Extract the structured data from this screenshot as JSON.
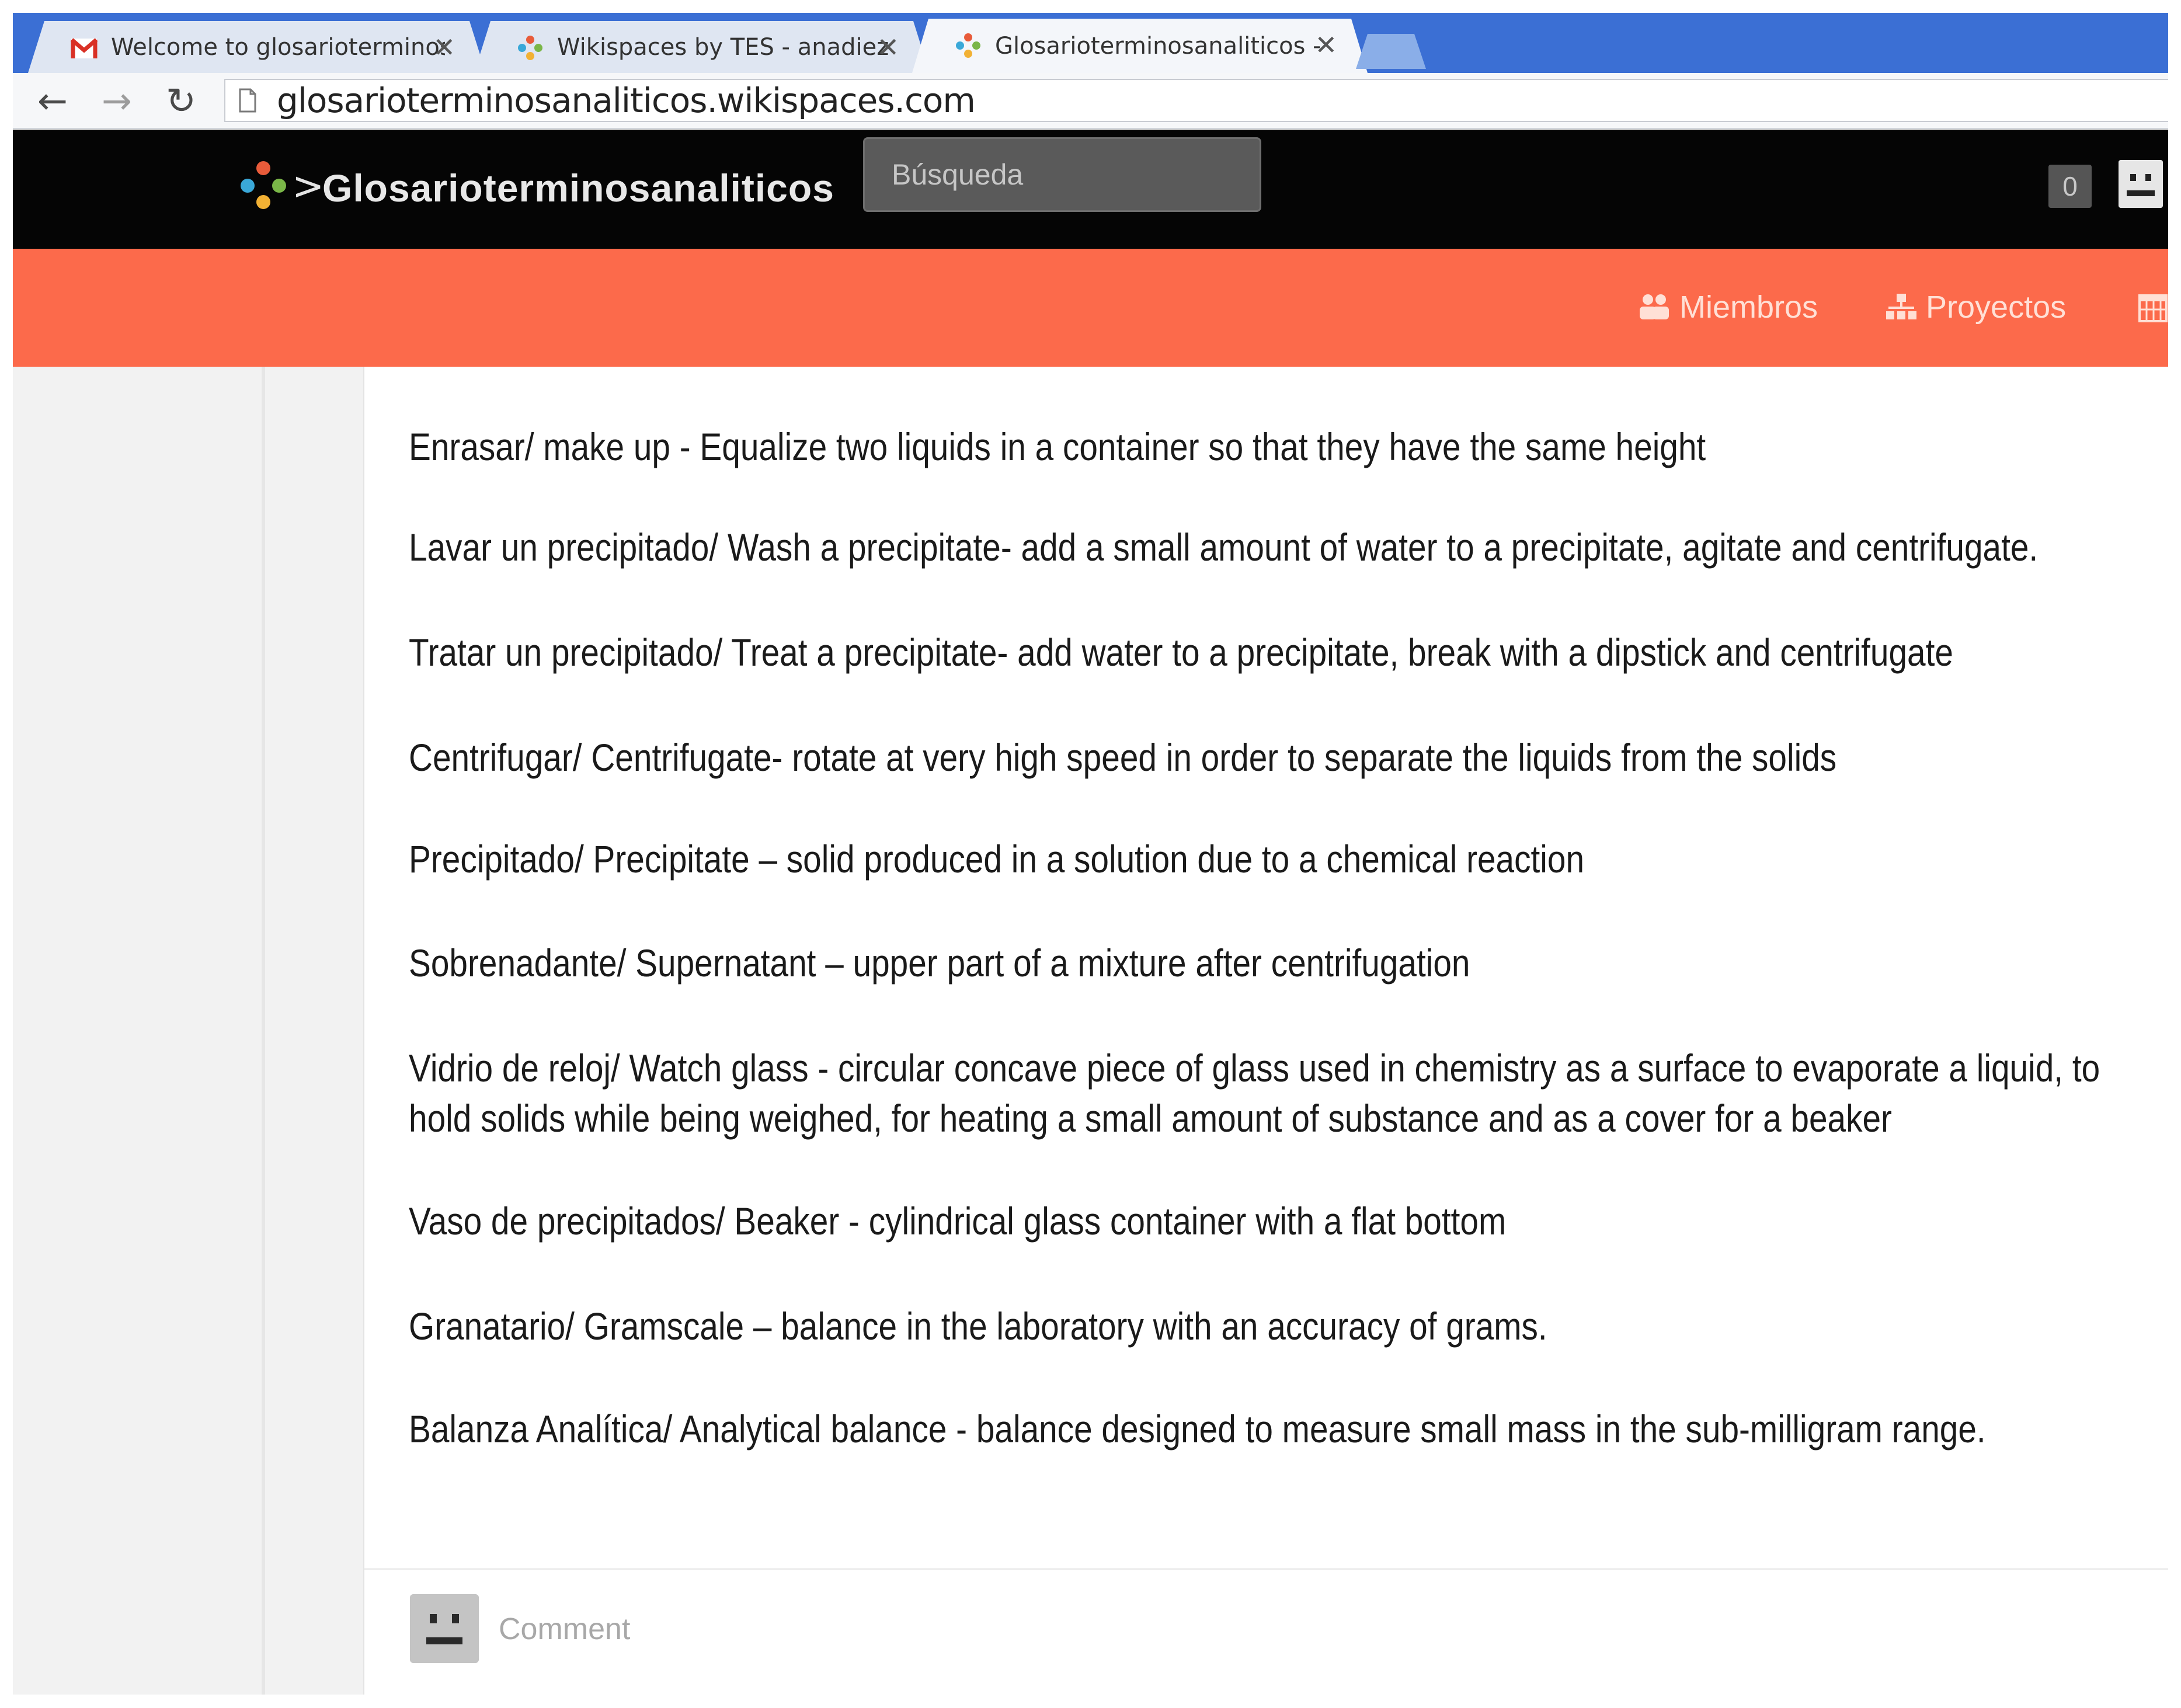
{
  "browser": {
    "tabs": [
      {
        "title": "Welcome to glosarioterminos",
        "icon": "gmail-icon"
      },
      {
        "title": "Wikispaces by TES - anadiez",
        "icon": "wikispaces-icon"
      },
      {
        "title": "Glosarioterminosanaliticos - F",
        "icon": "wikispaces-icon",
        "active": true
      }
    ],
    "close_glyph": "✕",
    "back_glyph": "←",
    "forward_glyph": "→",
    "reload_glyph": "↻",
    "url": "glosarioterminosanaliticos.wikispaces.com"
  },
  "site": {
    "breadcrumb_sep": ">",
    "name": "Glosarioterminosanaliticos",
    "search_placeholder": "Búsqueda",
    "notification_count": "0"
  },
  "nav": {
    "members_label": "Miembros",
    "projects_label": "Proyectos"
  },
  "glossary": [
    "Enrasar/ make up - Equalize two liquids in a container so that they have the same height",
    "Lavar un precipitado/ Wash a precipitate- add a small amount of water to a precipitate, agitate and centrifugate.",
    "Tratar un precipitado/ Treat a precipitate- add water to a precipitate, break with a dipstick and centrifugate",
    "Centrifugar/ Centrifugate- rotate at very high speed in order to separate the liquids from the solids",
    "Precipitado/  Precipitate – solid produced in a solution due to a chemical reaction",
    "Sobrenadante/ Supernatant – upper part of a mixture after  centrifugation",
    "Vidrio de reloj/ Watch glass - circular concave piece of glass used in chemistry as a surface to evaporate a liquid, to hold solids while being weighed, for heating a small amount of substance and as a cover for a beaker",
    "Vaso de precipitados/ Beaker - cylindrical glass container with a flat bottom",
    "Granatario/ Gramscale – balance in the laboratory with an accuracy of grams.",
    "Balanza Analítica/ Analytical balance - balance designed to measure small mass in the sub-milligram range."
  ],
  "comment": {
    "placeholder": "Comment"
  },
  "colors": {
    "tab_strip": "#3b6fd4",
    "header_bg": "#050505",
    "nav_orange": "#fc6a4b"
  }
}
